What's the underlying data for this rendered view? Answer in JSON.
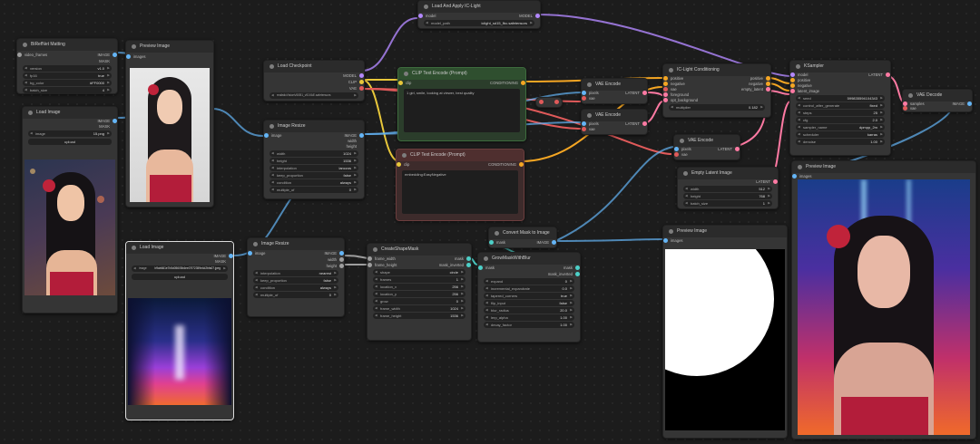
{
  "nodes": {
    "birefnet": {
      "title": "BiRefNet Matting",
      "out1": "IMAGE",
      "out2": "MASK",
      "in1": "video_frames",
      "w": [
        [
          "version",
          "v1.0"
        ],
        [
          "fp16",
          "true"
        ],
        [
          "bg_color",
          "#FF0000"
        ],
        [
          "batch_size",
          "4"
        ]
      ]
    },
    "preview1": {
      "title": "Preview Image",
      "in1": "images"
    },
    "loadimg1": {
      "title": "Load Image",
      "out1": "IMAGE",
      "out2": "MASK",
      "w_image": "image",
      "w_image_val": "15.png",
      "upload": "upload"
    },
    "loadimg2": {
      "title": "Load Image",
      "out1": "IMAGE",
      "out2": "MASK",
      "w_image": "image",
      "w_image_val": "b9ab661e7b5d05605b4ee07f72359e4d2bfa07.jpeg",
      "upload": "upload"
    },
    "ckpt": {
      "title": "Load Checkpoint",
      "out1": "MODEL",
      "out2": "CLIP",
      "out3": "VAE",
      "w_ckpt": "ckpt_name",
      "w_ckpt_val": "realisticVisionV60B1_v51VAE.safetensors"
    },
    "resize1": {
      "title": "Image Resize",
      "in1": "image",
      "out1": "IMAGE",
      "out2": "width",
      "out3": "height",
      "w": [
        [
          "width",
          "1024"
        ],
        [
          "height",
          "1536"
        ],
        [
          "interpolation",
          "lanczos"
        ],
        [
          "keep_proportion",
          "false"
        ],
        [
          "condition",
          "always"
        ],
        [
          "multiple_of",
          "0"
        ]
      ]
    },
    "resize2": {
      "title": "Image Resize",
      "in1": "image",
      "out1": "IMAGE",
      "out2": "width",
      "out3": "height",
      "w": [
        [
          "interpolation",
          "nearest"
        ],
        [
          "keep_proportion",
          "false"
        ],
        [
          "condition",
          "always"
        ],
        [
          "multiple_of",
          "0"
        ]
      ]
    },
    "iclight": {
      "title": "Load And Apply IC-Light",
      "in1": "model",
      "out1": "MODEL",
      "w_model": "model_path",
      "w_model_val": "iclight_sd15_fbc.safetensors"
    },
    "clip_pos": {
      "title": "CLIP Text Encode (Prompt)",
      "in1": "clip",
      "out1": "CONDITIONING",
      "text": "1 girl, smile, looking at viewer, best quality"
    },
    "clip_neg": {
      "title": "CLIP Text Encode (Prompt)",
      "in1": "clip",
      "out1": "CONDITIONING",
      "text": "embedding:EasyNegative"
    },
    "vae_enc1": {
      "title": "VAE Encode",
      "in1": "pixels",
      "in2": "vae",
      "out1": "LATENT"
    },
    "vae_enc2": {
      "title": "VAE Encode",
      "in1": "pixels",
      "in2": "vae",
      "out1": "LATENT"
    },
    "vae_enc3": {
      "title": "VAE Encode",
      "in1": "pixels",
      "in2": "vae",
      "out1": "LATENT"
    },
    "iccond": {
      "title": "IC-Light Conditioning",
      "in": [
        "positive",
        "negative",
        "vae",
        "foreground",
        "opt_background"
      ],
      "out": [
        "positive",
        "negative",
        "empty_latent"
      ],
      "w": [
        [
          "multiplier",
          "0.182"
        ]
      ]
    },
    "ksampler": {
      "title": "KSampler",
      "in": [
        "model",
        "positive",
        "negative",
        "latent_image"
      ],
      "out1": "LATENT",
      "w": [
        [
          "seed",
          "599835594104343"
        ],
        [
          "control_after_generate",
          "fixed"
        ],
        [
          "steps",
          "25"
        ],
        [
          "cfg",
          "2.0"
        ],
        [
          "sampler_name",
          "dpmpp_2m"
        ],
        [
          "scheduler",
          "karras"
        ],
        [
          "denoise",
          "1.00"
        ]
      ]
    },
    "vae_dec": {
      "title": "VAE Decode",
      "in1": "samples",
      "in2": "vae",
      "out1": "IMAGE"
    },
    "empty_latent": {
      "title": "Empty Latent Image",
      "out1": "LATENT",
      "w": [
        [
          "width",
          "512"
        ],
        [
          "height",
          "768"
        ],
        [
          "batch_size",
          "1"
        ]
      ]
    },
    "preview_final": {
      "title": "Preview Image",
      "in1": "images"
    },
    "preview_mask": {
      "title": "Preview Image",
      "in1": "images"
    },
    "convert_mask": {
      "title": "Convert Mask to Image",
      "in1": "mask",
      "out1": "IMAGE"
    },
    "create_shape": {
      "title": "CreateShapeMask",
      "in1": "frame_width",
      "in2": "frame_height",
      "out1": "mask",
      "out2": "mask_inverted",
      "w": [
        [
          "shape",
          "circle"
        ],
        [
          "frames",
          "1"
        ],
        [
          "location_x",
          "256"
        ],
        [
          "location_y",
          "256"
        ],
        [
          "grow",
          "0"
        ],
        [
          "frame_width",
          "1024"
        ],
        [
          "frame_height",
          "1536"
        ]
      ]
    },
    "grow_mask": {
      "title": "GrowMaskWithBlur",
      "in1": "mask",
      "out1": "mask",
      "out2": "mask_inverted",
      "w": [
        [
          "expand",
          "0"
        ],
        [
          "incremental_expandrate",
          "0.0"
        ],
        [
          "tapered_corners",
          "true"
        ],
        [
          "flip_input",
          "false"
        ],
        [
          "blur_radius",
          "20.0"
        ],
        [
          "lerp_alpha",
          "1.00"
        ],
        [
          "decay_factor",
          "1.00"
        ]
      ]
    }
  },
  "colors": {
    "bg": "#1c1c1c",
    "node": "#353535",
    "clip_pos": "#2b4a2b",
    "clip_neg": "#4a2b2b"
  }
}
